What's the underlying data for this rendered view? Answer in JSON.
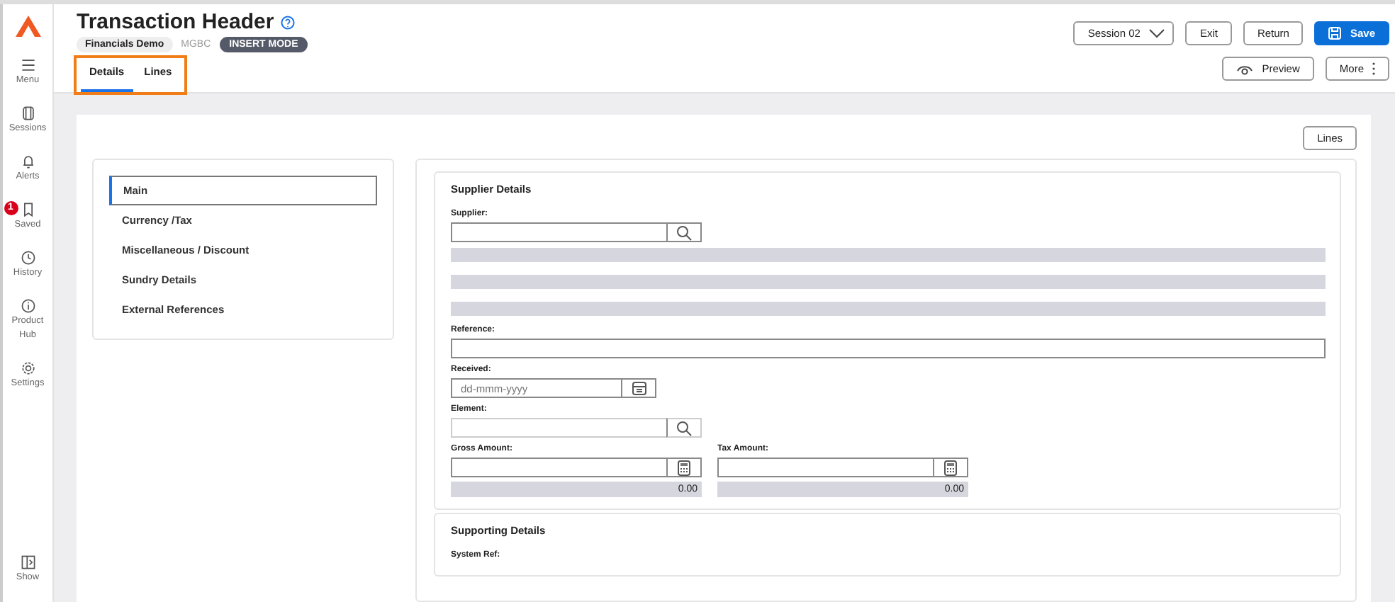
{
  "rail": {
    "items": [
      {
        "kind": "menu",
        "label": "Menu"
      },
      {
        "kind": "sessions",
        "label": "Sessions"
      },
      {
        "kind": "alerts",
        "label": "Alerts"
      },
      {
        "kind": "saved",
        "label": "Saved",
        "badge": "1"
      },
      {
        "kind": "history",
        "label": "History"
      },
      {
        "kind": "info",
        "label": "Product Hub"
      },
      {
        "kind": "settings",
        "label": "Settings"
      }
    ],
    "bottom": {
      "kind": "show",
      "label": "Show"
    }
  },
  "header": {
    "title": "Transaction Header",
    "company": "Financials Demo",
    "code": "MGBC",
    "mode": "INSERT MODE",
    "session": "Session 02",
    "buttons": [
      "Exit",
      "Return",
      "Save"
    ],
    "preview": "Preview",
    "more": "More"
  },
  "tabs": [
    {
      "label": "Details",
      "selected": true
    },
    {
      "label": "Lines",
      "selected": false
    }
  ],
  "lines_button": "Lines",
  "nav": [
    {
      "label": "Main",
      "selected": true
    },
    {
      "label": "Currency /Tax",
      "selected": false
    },
    {
      "label": "Miscellaneous / Discount",
      "selected": false
    },
    {
      "label": "Sundry Details",
      "selected": false
    },
    {
      "label": "External References",
      "selected": false
    }
  ],
  "supplier_details": {
    "title": "Supplier Details",
    "supplier_label": "Supplier:",
    "reference_label": "Reference:",
    "received_label": "Received:",
    "received_placeholder": "dd-mmm-yyyy",
    "element_label": "Element:",
    "element_disabled": true,
    "amounts": [
      {
        "label": "Gross Amount:",
        "total": "0.00"
      },
      {
        "label": "Tax Amount:",
        "total": "0.00"
      }
    ]
  },
  "supporting_details": {
    "title": "Supporting Details",
    "system_ref_label": "System Ref:"
  }
}
